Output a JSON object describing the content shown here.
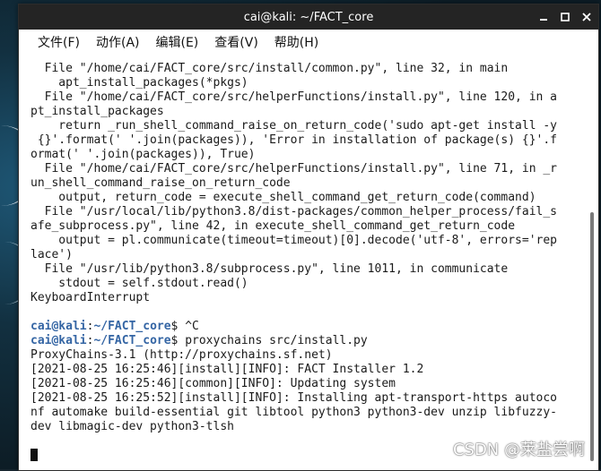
{
  "window": {
    "title": "cai@kali: ~/FACT_core"
  },
  "menu": [
    "文件(F)",
    "动作(A)",
    "编辑(E)",
    "查看(V)",
    "帮助(H)"
  ],
  "terminal": {
    "lines": [
      {
        "type": "text",
        "text": "  File \"/home/cai/FACT_core/src/install/common.py\", line 32, in main"
      },
      {
        "type": "text",
        "text": "    apt_install_packages(*pkgs)"
      },
      {
        "type": "text",
        "text": "  File \"/home/cai/FACT_core/src/helperFunctions/install.py\", line 120, in a"
      },
      {
        "type": "text",
        "text": "pt_install_packages"
      },
      {
        "type": "text",
        "text": "    return _run_shell_command_raise_on_return_code('sudo apt-get install -y"
      },
      {
        "type": "text",
        "text": " {}'.format(' '.join(packages)), 'Error in installation of package(s) {}'.f"
      },
      {
        "type": "text",
        "text": "ormat(' '.join(packages)), True)"
      },
      {
        "type": "text",
        "text": "  File \"/home/cai/FACT_core/src/helperFunctions/install.py\", line 71, in _r"
      },
      {
        "type": "text",
        "text": "un_shell_command_raise_on_return_code"
      },
      {
        "type": "text",
        "text": "    output, return_code = execute_shell_command_get_return_code(command)"
      },
      {
        "type": "text",
        "text": "  File \"/usr/local/lib/python3.8/dist-packages/common_helper_process/fail_s"
      },
      {
        "type": "text",
        "text": "afe_subprocess.py\", line 42, in execute_shell_command_get_return_code"
      },
      {
        "type": "text",
        "text": "    output = pl.communicate(timeout=timeout)[0].decode('utf-8', errors='rep"
      },
      {
        "type": "text",
        "text": "lace')"
      },
      {
        "type": "text",
        "text": "  File \"/usr/lib/python3.8/subprocess.py\", line 1011, in communicate"
      },
      {
        "type": "text",
        "text": "    stdout = self.stdout.read()"
      },
      {
        "type": "text",
        "text": "KeyboardInterrupt"
      },
      {
        "type": "text",
        "text": ""
      },
      {
        "type": "prompt",
        "user": "cai@kali",
        "path": "~/FACT_core",
        "symbol": "$ ",
        "command": "^C"
      },
      {
        "type": "prompt",
        "user": "cai@kali",
        "path": "~/FACT_core",
        "symbol": "$ ",
        "command": "proxychains src/install.py"
      },
      {
        "type": "text",
        "text": "ProxyChains-3.1 (http://proxychains.sf.net)"
      },
      {
        "type": "text",
        "text": "[2021-08-25 16:25:46][install][INFO]: FACT Installer 1.2"
      },
      {
        "type": "text",
        "text": "[2021-08-25 16:25:46][common][INFO]: Updating system"
      },
      {
        "type": "text",
        "text": "[2021-08-25 16:25:52][install][INFO]: Installing apt-transport-https autoco"
      },
      {
        "type": "text",
        "text": "nf automake build-essential git libtool python3 python3-dev unzip libfuzzy-"
      },
      {
        "type": "text",
        "text": "dev libmagic-dev python3-tlsh"
      },
      {
        "type": "text",
        "text": ""
      },
      {
        "type": "cursor"
      }
    ]
  },
  "watermark": "CSDN @莱盐尝啊"
}
